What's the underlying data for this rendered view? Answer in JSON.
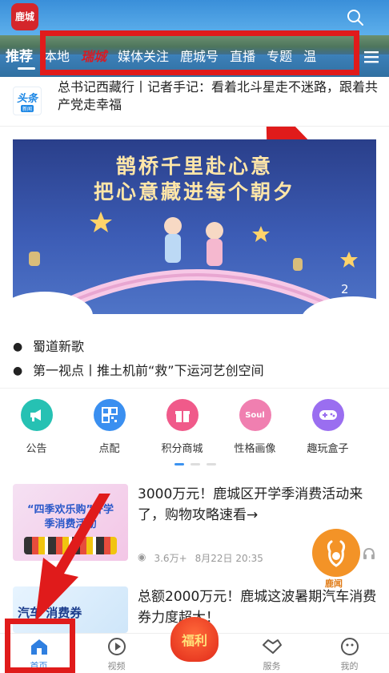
{
  "app": {
    "logo_text": "鹿城"
  },
  "header": {
    "tabs": [
      {
        "label": "推荐",
        "active": true
      },
      {
        "label": "本地"
      },
      {
        "label": "瑞城",
        "special": true
      },
      {
        "label": "媒体关注"
      },
      {
        "label": "鹿城号"
      },
      {
        "label": "直播"
      },
      {
        "label": "专题"
      },
      {
        "label": "温"
      }
    ]
  },
  "top_news": {
    "badge_main": "头条",
    "badge_sub": "新闻",
    "text": "总书记西藏行丨记者手记：看着北斗星走不迷路，跟着共产党走幸福"
  },
  "banner": {
    "line1": "鹊桥千里赴心意",
    "line2": "把心意藏进每个朝夕",
    "page_indicator": "2"
  },
  "bullets": [
    {
      "text": "蜀道新歌"
    },
    {
      "text": "第一视点丨推土机前“救”下运河艺创空间"
    }
  ],
  "quick_icons": [
    {
      "label": "公告",
      "color": "#26c1b3",
      "glyph": "📢"
    },
    {
      "label": "点配",
      "color": "#3a8ff0",
      "glyph": "▦"
    },
    {
      "label": "积分商城",
      "color": "#f05a8a",
      "glyph": "🎁"
    },
    {
      "label": "性格画像",
      "color": "#f07fb0",
      "glyph": "Soul"
    },
    {
      "label": "趣玩盒子",
      "color": "#9a6ef0",
      "glyph": "🎮"
    }
  ],
  "articles": [
    {
      "title": "3000万元！鹿城区开学季消费活动来了，购物攻略速看→",
      "thumb_text": "“四季欢乐购”开学季消费活动",
      "views": "3.6万+",
      "time": "8月22日 20:35"
    },
    {
      "title": "总额2000万元！鹿城这波暑期汽车消费券力度超大！",
      "thumb_text": "汽车 消费券"
    }
  ],
  "float": {
    "label": "鹿闻"
  },
  "bottom_nav": [
    {
      "label": "首页",
      "active": true
    },
    {
      "label": "视频"
    },
    {
      "label": "福利"
    },
    {
      "label": "服务"
    },
    {
      "label": "我的"
    }
  ],
  "colors": {
    "accent": "#2f7fe0",
    "highlight_box": "#e01b1b"
  }
}
